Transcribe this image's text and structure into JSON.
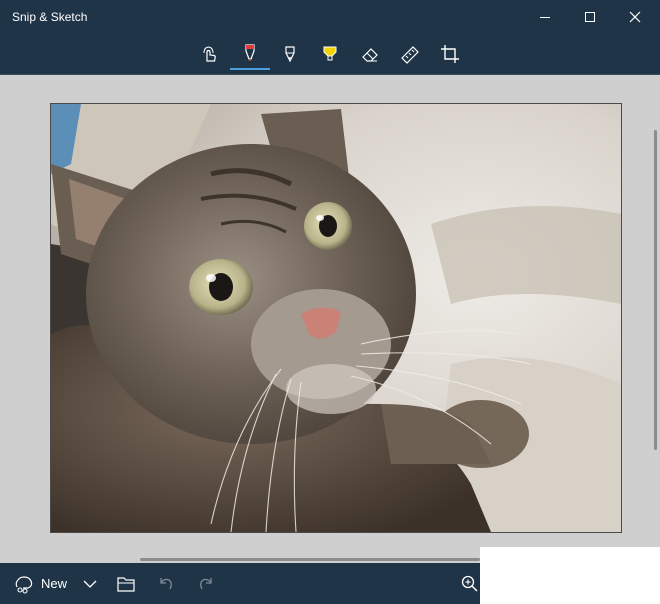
{
  "window": {
    "title": "Snip & Sketch"
  },
  "window_controls": [
    "minimize-icon",
    "maximize-icon",
    "close-icon"
  ],
  "toolbar": {
    "tools": [
      {
        "name": "touch-writing-icon",
        "active": false
      },
      {
        "name": "ballpoint-pen-icon",
        "active": true
      },
      {
        "name": "pencil-icon",
        "active": false
      },
      {
        "name": "highlighter-icon",
        "active": false
      },
      {
        "name": "eraser-icon",
        "active": false
      },
      {
        "name": "ruler-icon",
        "active": false
      },
      {
        "name": "crop-icon",
        "active": false
      }
    ],
    "pen_color": "#e33b3b",
    "highlighter_color": "#f2d200"
  },
  "canvas": {
    "image": "cat-photo"
  },
  "bottom_bar": {
    "new_label": "New",
    "buttons": [
      "new-snip-icon",
      "new-dropdown-chevron-icon",
      "open-folder-icon",
      "undo-icon",
      "redo-icon",
      "zoom-icon"
    ]
  },
  "colors": {
    "titlebar": "#1f3447",
    "accent": "#4c9fe0",
    "canvas_bg": "#cfcfcf"
  }
}
